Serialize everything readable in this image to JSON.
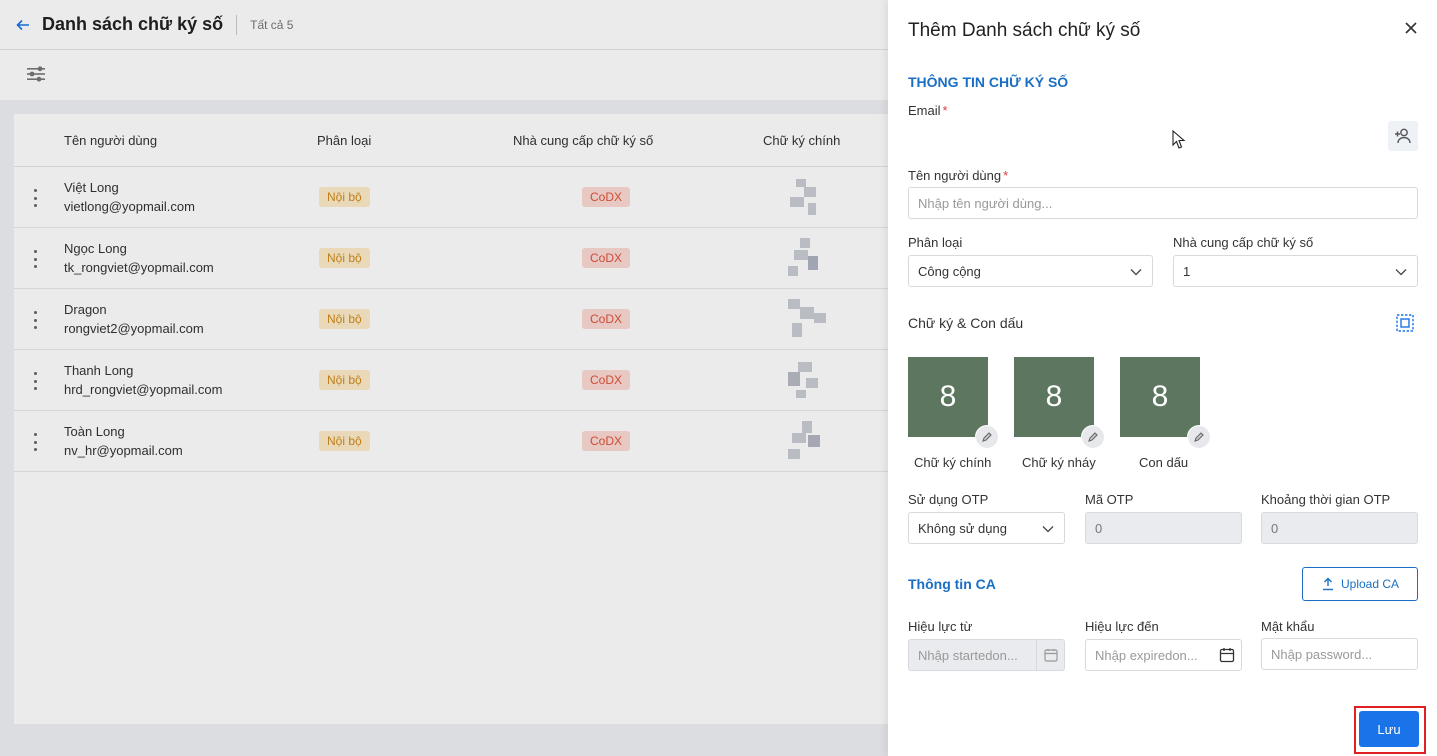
{
  "page": {
    "title": "Danh sách chữ ký số",
    "count": "Tất cả 5"
  },
  "table": {
    "headers": {
      "user": "Tên người dùng",
      "category": "Phân loại",
      "provider": "Nhà cung cấp chữ ký số",
      "main_signature": "Chữ ký chính"
    },
    "rows": [
      {
        "name": "Việt Long",
        "email": "vietlong@yopmail.com",
        "category": "Nội bộ",
        "provider": "CoDX"
      },
      {
        "name": "Ngọc Long",
        "email": "tk_rongviet@yopmail.com",
        "category": "Nội bộ",
        "provider": "CoDX"
      },
      {
        "name": "Dragon",
        "email": "rongviet2@yopmail.com",
        "category": "Nội bộ",
        "provider": "CoDX"
      },
      {
        "name": "Thanh Long",
        "email": "hrd_rongviet@yopmail.com",
        "category": "Nội bộ",
        "provider": "CoDX"
      },
      {
        "name": "Toàn Long",
        "email": "nv_hr@yopmail.com",
        "category": "Nội bộ",
        "provider": "CoDX"
      }
    ]
  },
  "panel": {
    "title": "Thêm Danh sách chữ ký số",
    "section_info": "THÔNG TIN CHỮ KÝ SỐ",
    "email_label": "Email",
    "required_mark": "*",
    "username_label": "Tên người dùng",
    "username_placeholder": "Nhập tên người dùng...",
    "category_label": "Phân loại",
    "category_value": "Công cộng",
    "provider_label": "Nhà cung cấp chữ ký số",
    "provider_value": "1",
    "sig_section_label": "Chữ ký & Con dấu",
    "signatures": [
      {
        "text": "8",
        "caption": "Chữ ký chính"
      },
      {
        "text": "8",
        "caption": "Chữ ký nháy"
      },
      {
        "text": "8",
        "caption": "Con dấu"
      }
    ],
    "otp_label": "Sử dụng OTP",
    "otp_value": "Không sử dụng",
    "otp_code_label": "Mã OTP",
    "otp_code_value": "0",
    "otp_duration_label": "Khoảng thời gian OTP",
    "otp_duration_value": "0",
    "ca_section": "Thông tin CA",
    "upload_label": "Upload CA",
    "valid_from_label": "Hiệu lực từ",
    "valid_from_placeholder": "Nhập startedon...",
    "valid_to_label": "Hiệu lực đến",
    "valid_to_placeholder": "Nhập expiredon...",
    "password_label": "Mật khẩu",
    "password_placeholder": "Nhập password...",
    "save_label": "Lưu"
  },
  "colors": {
    "accent": "#1a73e8",
    "section": "#1a6fc4",
    "sig_box": "#5c7660",
    "badge_internal_bg": "#fdecc8",
    "badge_codx_bg": "#fbd9d3",
    "highlight_frame": "#e02020"
  }
}
